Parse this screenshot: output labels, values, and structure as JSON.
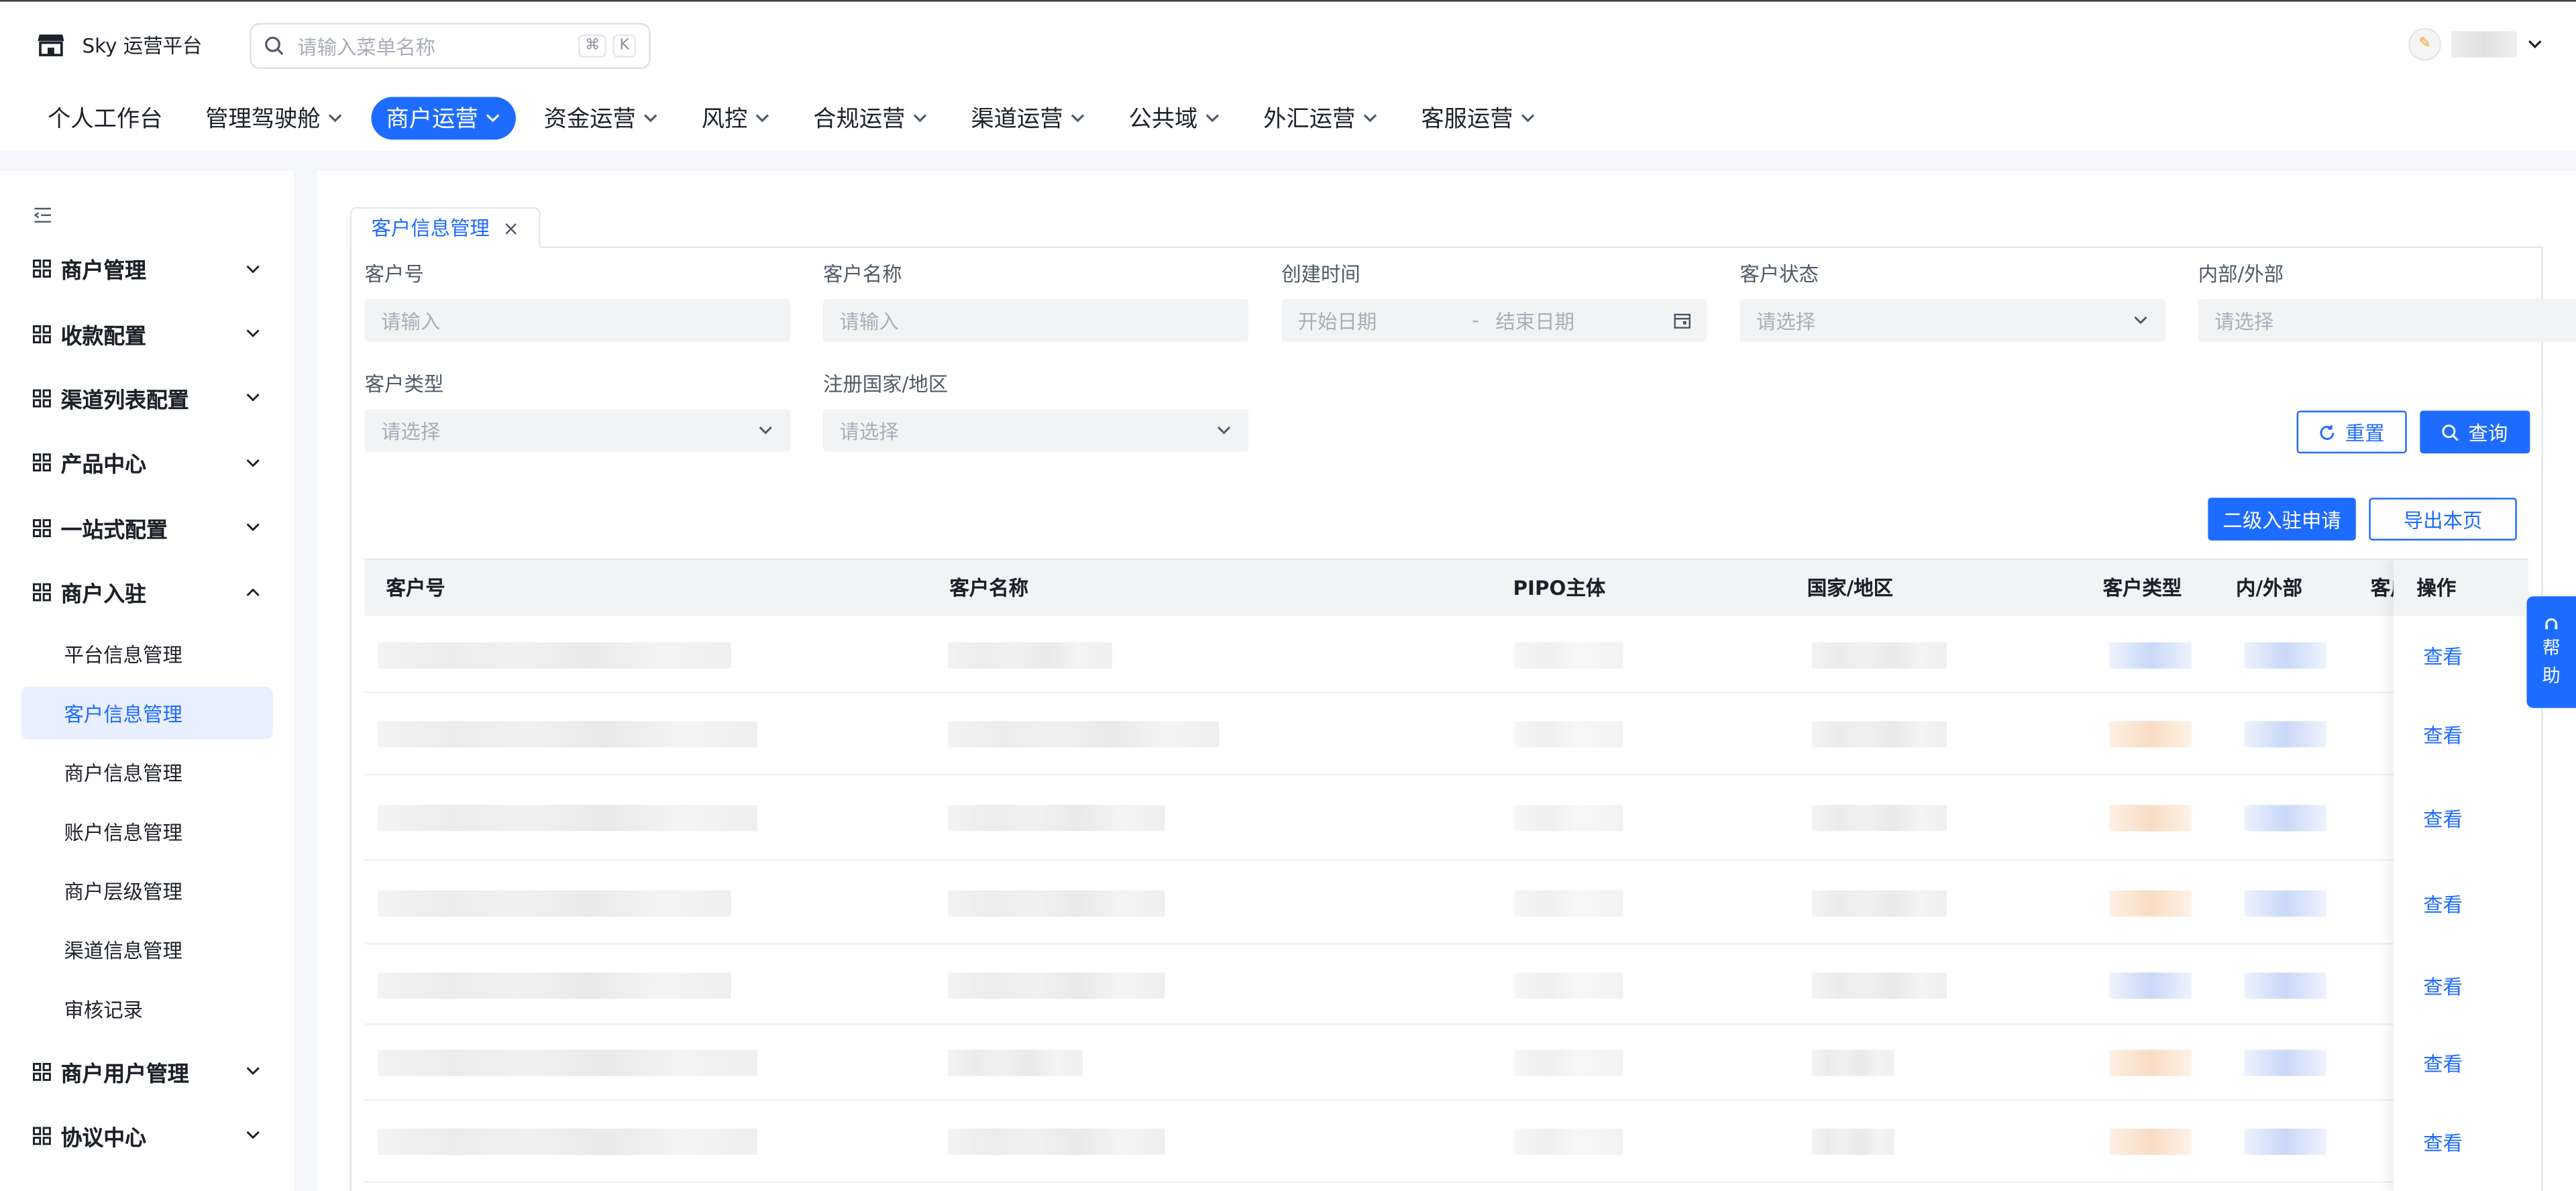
{
  "app": {
    "title": "Sky 运营平台",
    "search_placeholder": "请输入菜单名称",
    "search_kbd": [
      "⌘",
      "K"
    ]
  },
  "nav": {
    "items": [
      {
        "label": "个人工作台",
        "has_menu": false,
        "active": false
      },
      {
        "label": "管理驾驶舱",
        "has_menu": true,
        "active": false
      },
      {
        "label": "商户运营",
        "has_menu": true,
        "active": true
      },
      {
        "label": "资金运营",
        "has_menu": true,
        "active": false
      },
      {
        "label": "风控",
        "has_menu": true,
        "active": false
      },
      {
        "label": "合规运营",
        "has_menu": true,
        "active": false
      },
      {
        "label": "渠道运营",
        "has_menu": true,
        "active": false
      },
      {
        "label": "公共域",
        "has_menu": true,
        "active": false
      },
      {
        "label": "外汇运营",
        "has_menu": true,
        "active": false
      },
      {
        "label": "客服运营",
        "has_menu": true,
        "active": false
      }
    ]
  },
  "sidebar": {
    "groups": [
      {
        "label": "商户管理",
        "expanded": false
      },
      {
        "label": "收款配置",
        "expanded": false
      },
      {
        "label": "渠道列表配置",
        "expanded": false
      },
      {
        "label": "产品中心",
        "expanded": false
      },
      {
        "label": "一站式配置",
        "expanded": false
      },
      {
        "label": "商户入驻",
        "expanded": true
      },
      {
        "label": "商户用户管理",
        "expanded": false
      },
      {
        "label": "协议中心",
        "expanded": false
      }
    ],
    "sub_items": [
      {
        "label": "平台信息管理",
        "active": false
      },
      {
        "label": "客户信息管理",
        "active": true
      },
      {
        "label": "商户信息管理",
        "active": false
      },
      {
        "label": "账户信息管理",
        "active": false
      },
      {
        "label": "商户层级管理",
        "active": false
      },
      {
        "label": "渠道信息管理",
        "active": false
      },
      {
        "label": "审核记录",
        "active": false
      }
    ]
  },
  "tabs": [
    {
      "label": "客户信息管理",
      "close": "×"
    }
  ],
  "filters": {
    "customer_no": {
      "label": "客户号",
      "placeholder": "请输入"
    },
    "customer_name": {
      "label": "客户名称",
      "placeholder": "请输入"
    },
    "created_time": {
      "label": "创建时间",
      "start_placeholder": "开始日期",
      "separator": "-",
      "end_placeholder": "结束日期"
    },
    "customer_status": {
      "label": "客户状态",
      "placeholder": "请选择"
    },
    "internal_external": {
      "label": "内部/外部",
      "placeholder": "请选择"
    },
    "customer_type": {
      "label": "客户类型",
      "placeholder": "请选择"
    },
    "country": {
      "label": "注册国家/地区",
      "placeholder": "请选择"
    }
  },
  "buttons": {
    "reset": "重置",
    "query": "查询",
    "secondary_apply": "二级入驻申请",
    "export_page": "导出本页"
  },
  "table": {
    "columns": [
      "客户号",
      "客户名称",
      "PIPO主体",
      "国家/地区",
      "客户类型",
      "内/外部",
      "客户",
      "操作"
    ],
    "row_action": "查看",
    "row_count": 7
  },
  "help": {
    "line1": "帮",
    "line2": "助"
  },
  "colors": {
    "accent": "#1e6bff",
    "active_bg": "#e8effe",
    "page_bg": "#f4f6f9"
  }
}
